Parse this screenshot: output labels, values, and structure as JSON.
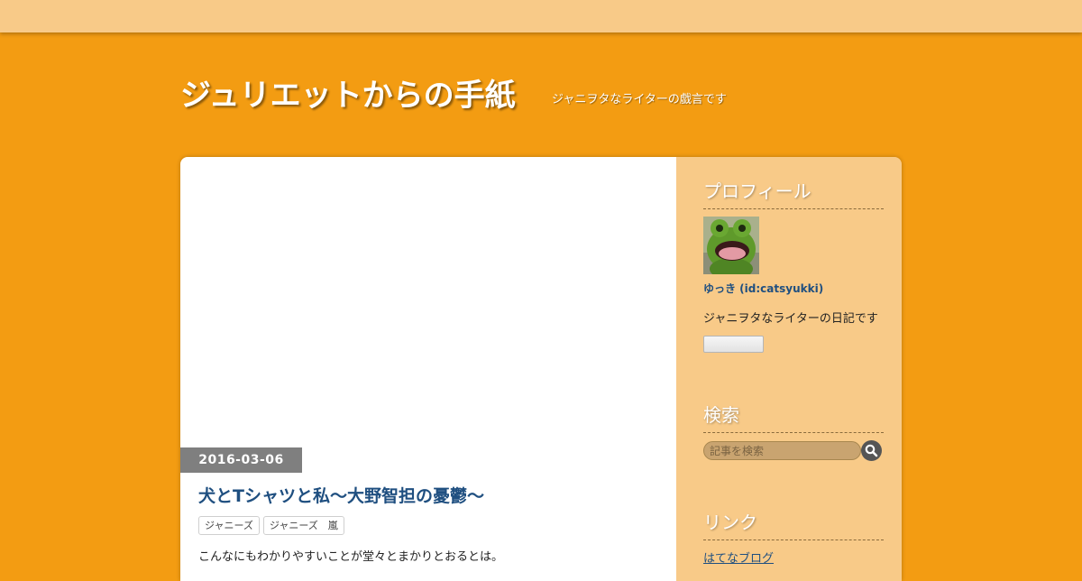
{
  "header": {
    "blog_title": "ジュリエットからの手紙",
    "blog_description": "ジャニヲタなライターの戯言です"
  },
  "entry": {
    "date": "2016-03-06",
    "title": "犬とTシャツと私～大野智担の憂鬱～",
    "categories": [
      "ジャニーズ",
      "ジャニーズ　嵐"
    ],
    "body_first_line": "こんなにもわかりやすいことが堂々とまかりとおるとは。"
  },
  "sidebar": {
    "profile": {
      "title": "プロフィール",
      "name": "ゆっき (id:catsyukki)",
      "description": "ジャニヲタなライターの日記です",
      "icon": "frog-avatar"
    },
    "search": {
      "title": "検索",
      "placeholder": "記事を検索",
      "icon": "magnifier-icon"
    },
    "links": {
      "title": "リンク",
      "items": [
        "はてなブログ"
      ]
    }
  },
  "colors": {
    "background": "#f39c12",
    "topbar": "#f8ca88",
    "sidebar": "#f8ca88",
    "link": "#1f4f80",
    "date_badge": "#7f7f7f"
  }
}
